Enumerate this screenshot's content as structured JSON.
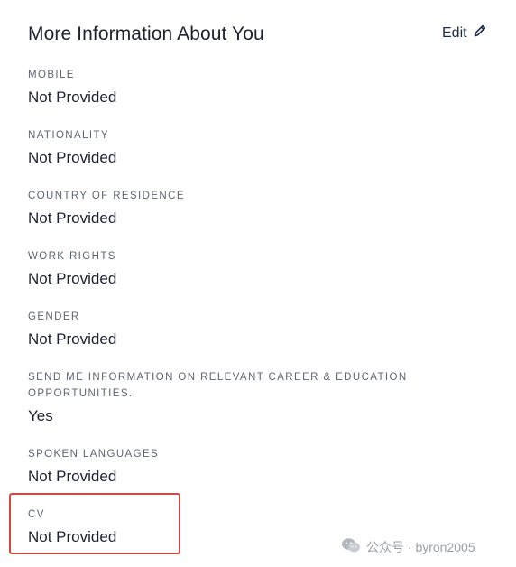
{
  "section": {
    "title": "More Information About You",
    "edit_label": "Edit"
  },
  "fields": [
    {
      "label": "MOBILE",
      "value": "Not Provided"
    },
    {
      "label": "NATIONALITY",
      "value": "Not Provided"
    },
    {
      "label": "COUNTRY OF RESIDENCE",
      "value": "Not Provided"
    },
    {
      "label": "WORK RIGHTS",
      "value": "Not Provided"
    },
    {
      "label": "GENDER",
      "value": "Not Provided"
    },
    {
      "label": "SEND ME INFORMATION ON RELEVANT CAREER & EDUCATION OPPORTUNITIES.",
      "value": "Yes"
    },
    {
      "label": "SPOKEN LANGUAGES",
      "value": "Not Provided"
    },
    {
      "label": "CV",
      "value": "Not Provided"
    }
  ],
  "watermark": {
    "text": "公众号 · byron2005"
  },
  "colors": {
    "highlight": "#cf4a41",
    "text": "#1e2230",
    "label": "#5e6370"
  }
}
